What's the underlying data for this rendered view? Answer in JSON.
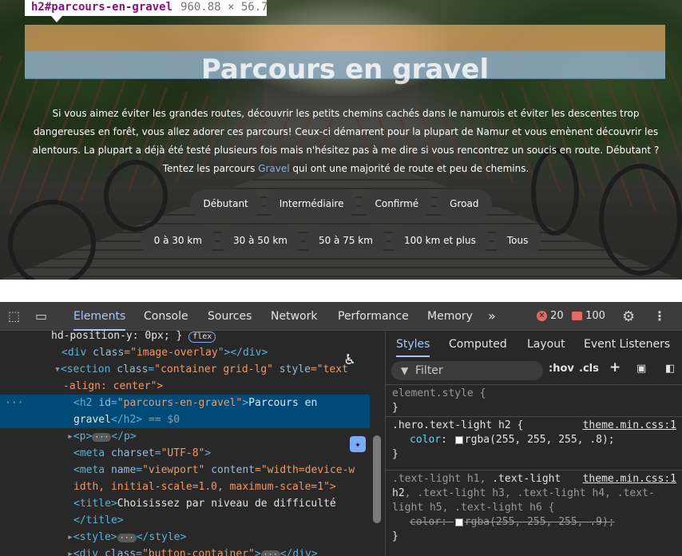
{
  "hero": {
    "tooltip_tag": "h2#parcours-en-gravel",
    "tooltip_dims": "960.88 × 56.7",
    "title": "Parcours en gravel",
    "desc_before_link": "Si vous aimez éviter les grandes routes, découvrir les petits chemins cachés dans le namurois et éviter les descentes trop dangereuses en forêt, vous allez adorer ces parcours! Ceux-ci démarrent pour la plupart de Namur et vous emènent découvrir les alentours. La plupart a déjà été testé plusieurs fois mais n'hésitez pas à me dire si vous rencontrez un soucis en route. Débutant ? Tentez les parcours ",
    "desc_link": "Gravel",
    "desc_after_link": " qui ont une majorité de route et peu de chemins.",
    "level_buttons": [
      "Débutant",
      "Intermédiaire",
      "Confirmé",
      "Groad"
    ],
    "distance_buttons": [
      "0 à 30 km",
      "30 à 50 km",
      "50 à 75 km",
      "100 km et plus",
      "Tous"
    ]
  },
  "devtools": {
    "tabs": [
      "Elements",
      "Console",
      "Sources",
      "Network",
      "Performance",
      "Memory"
    ],
    "more": "»",
    "error_count": "20",
    "warning_count": "100",
    "elements": {
      "line0_prop": "hd-position-y: 0px;",
      "line0_brace": " }",
      "flex_chip": "flex",
      "line1": [
        "<div ",
        "class",
        "=\"",
        "image-overlay",
        "\"></div>"
      ],
      "line2_tag": "<section ",
      "line2_attr": "class",
      "line2_val": "\"container grid-lg\"",
      "line2_attr2": " style",
      "line2_val2": "=\"text",
      "line3": "-align: center\">",
      "line4_tag": "<h2 ",
      "line4_attr": "id",
      "line4_val": "\"parcours-en-gravel\"",
      "line4_text": "Parcours en",
      "line5_text": "gravel",
      "line5_close": "</h2>",
      "line5_eq": " == $0",
      "line6_open": "<p>",
      "line6_close": "</p>",
      "line7_tag": "<meta ",
      "line7_attr": "charset",
      "line7_val": "\"UTF-8\"",
      "line8_tag": "<meta ",
      "line8_attr": "name",
      "line8_val": "\"viewport\"",
      "line8_attr2": " content",
      "line8_val2": "=\"width=device-w",
      "line9": "idth, initial-scale=1.0, maximum-scale=1\">",
      "line10_tag": "<title>",
      "line10_text": "Choisissez par niveau de difficulté",
      "line11": "</title>",
      "line12_open": "<style>",
      "line12_close": "</style>",
      "line13_tag": "<div ",
      "line13_attr": "class",
      "line13_val": "\"button-container\"",
      "line13_close": "</div>",
      "ellipsis": "···"
    },
    "styles": {
      "subtabs": [
        "Styles",
        "Computed",
        "Layout",
        "Event Listeners"
      ],
      "filter_placeholder": "Filter",
      "hov": ":hov",
      "cls": ".cls",
      "plus": "+",
      "rule0_selector": "element.style {",
      "rule0_close": "}",
      "rule1_selector": ".hero.text-light h2 {",
      "rule1_src": "theme.min.css:1",
      "rule1_prop": "color",
      "rule1_value": "rgba(255, 255, 255, .8);",
      "rule1_close": "}",
      "rule2_sel_a": ".text-light h1, ",
      "rule2_sel_b": ".text-light",
      "rule2_src": "theme.min.css:1",
      "rule2_sel_c": "h2",
      "rule2_sel_d": ", .text-light h3, .text-light h4, .text-",
      "rule2_sel_e": "light h5, .text-light h6 {",
      "rule2_prop": "color",
      "rule2_value": "rgba(255, 255, 255, .9);",
      "rule2_close": "}"
    }
  }
}
